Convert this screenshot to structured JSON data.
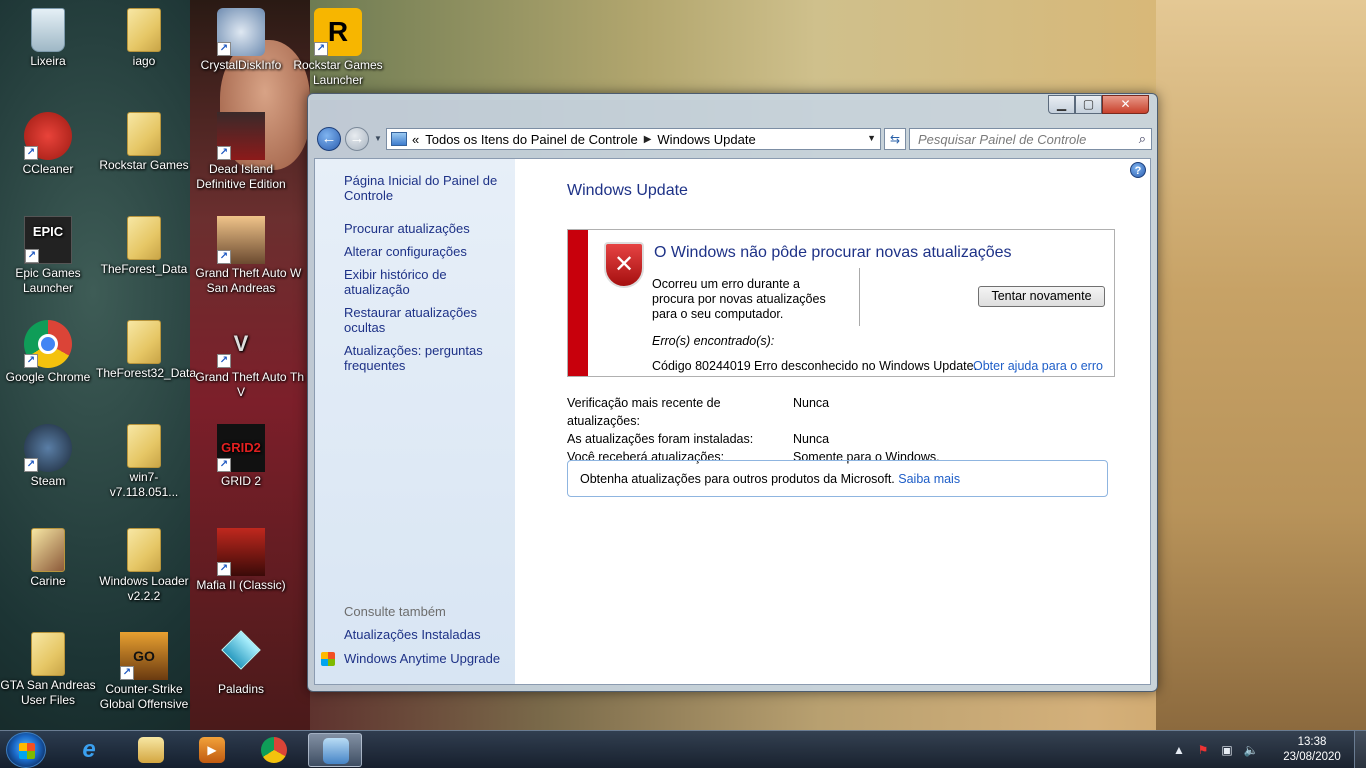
{
  "desktop": {
    "icons": [
      {
        "label": "Lixeira",
        "icon": "recycle-bin-icon"
      },
      {
        "label": "iago",
        "icon": "folder-icon"
      },
      {
        "label": "CrystalDiskInfo",
        "icon": "crystaldiskinfo-icon"
      },
      {
        "label": "Rockstar Games Launcher",
        "icon": "rockstar-icon"
      },
      {
        "label": "CCleaner",
        "icon": "ccleaner-icon"
      },
      {
        "label": "Rockstar Games",
        "icon": "folder-icon"
      },
      {
        "label": "Dead Island Definitive Edition",
        "icon": "dead-island-icon"
      },
      {
        "label": "Epic Games Launcher",
        "icon": "epic-games-icon"
      },
      {
        "label": "TheForest_Data",
        "icon": "folder-icon"
      },
      {
        "label": "Grand Theft Auto San Andreas",
        "icon": "gta-sa-icon"
      },
      {
        "label": "Google Chrome",
        "icon": "chrome-icon"
      },
      {
        "label": "TheForest32_Data",
        "icon": "folder-icon"
      },
      {
        "label": "Grand Theft Auto V",
        "icon": "gta-v-icon"
      },
      {
        "label": "Steam",
        "icon": "steam-icon"
      },
      {
        "label": "win7-v7.118.051...",
        "icon": "folder-icon"
      },
      {
        "label": "GRID 2",
        "icon": "grid2-icon"
      },
      {
        "label": "Carine",
        "icon": "folder-icon"
      },
      {
        "label": "Windows Loader v2.2.2",
        "icon": "folder-icon"
      },
      {
        "label": "Mafia II (Classic)",
        "icon": "mafia-icon"
      },
      {
        "label": "GTA San Andreas User Files",
        "icon": "folder-icon"
      },
      {
        "label": "Counter-Strike Global Offensive",
        "icon": "csgo-icon"
      },
      {
        "label": "Paladins",
        "icon": "paladins-icon"
      }
    ],
    "clipped_labels": {
      "w": "W",
      "th": "Th"
    }
  },
  "window": {
    "breadcrumb_prefix": "«",
    "breadcrumb": [
      "Todos os Itens do Painel de Controle",
      "Windows Update"
    ],
    "search_placeholder": "Pesquisar Painel de Controle",
    "left_nav": {
      "home": "Página Inicial do Painel de Controle",
      "links": [
        "Procurar atualizações",
        "Alterar configurações",
        "Exibir histórico de atualização",
        "Restaurar atualizações ocultas",
        "Atualizações: perguntas frequentes"
      ],
      "see_also_header": "Consulte também",
      "see_also": [
        "Atualizações Instaladas",
        "Windows Anytime Upgrade"
      ]
    },
    "main": {
      "title": "Windows Update",
      "error": {
        "title": "O Windows não pôde procurar novas atualizações",
        "description": "Ocorreu um erro durante a procura por novas atualizações para o seu computador.",
        "retry_button": "Tentar novamente",
        "found_label": "Erro(s) encontrado(s):",
        "code": "Código 80244019",
        "message": "Erro desconhecido no Windows Update.",
        "help_link": "Obter ajuda para o erro"
      },
      "info": [
        {
          "key": "Verificação mais recente de atualizações:",
          "value": "Nunca"
        },
        {
          "key": "As atualizações foram instaladas:",
          "value": "Nunca"
        },
        {
          "key": "Você receberá atualizações:",
          "value": "Somente para o Windows."
        }
      ],
      "ms_box": {
        "text": "Obtenha atualizações para outros produtos da Microsoft.",
        "link": "Saiba mais"
      }
    }
  },
  "taskbar": {
    "items": [
      "internet-explorer-icon",
      "windows-explorer-icon",
      "media-player-icon",
      "chrome-icon",
      "control-panel-icon"
    ],
    "time": "13:38",
    "date": "23/08/2020"
  }
}
